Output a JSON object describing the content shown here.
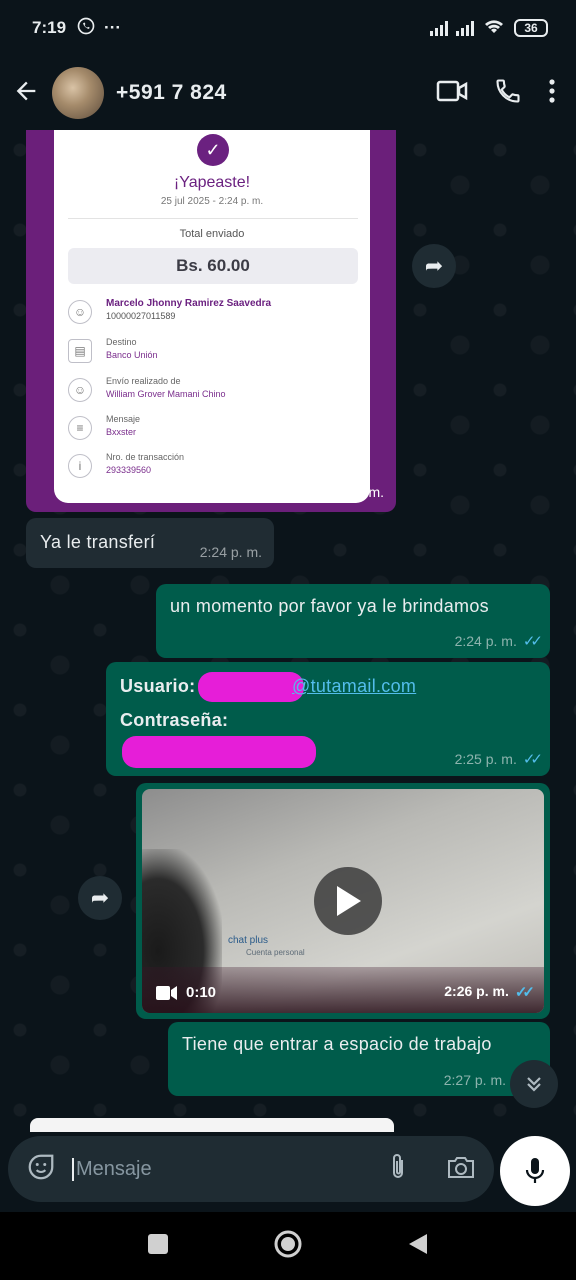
{
  "status_bar": {
    "time": "7:19",
    "more": "···",
    "battery": "36"
  },
  "header": {
    "contact": "+591 7   824"
  },
  "receipt": {
    "title": "¡Yapeaste!",
    "date": "25 jul 2025 - 2:24 p. m.",
    "total_label": "Total enviado",
    "amount": "Bs. 60.00",
    "rows": [
      {
        "label": "Marcelo Jhonny Ramirez Saavedra",
        "value": "10000027011589",
        "icon": "person-icon"
      },
      {
        "label": "Destino",
        "value": "Banco Unión",
        "icon": "bank-doc-icon"
      },
      {
        "label": "Envío realizado de",
        "value": "William Grover Mamani Chino",
        "icon": "person-icon"
      },
      {
        "label": "Mensaje",
        "value": "Bxxster",
        "icon": "message-icon"
      },
      {
        "label": "Nro. de transacción",
        "value": "293339560",
        "icon": "info-icon"
      }
    ],
    "time": "2:24 p. m."
  },
  "messages": [
    {
      "text": "Ya le transferí",
      "time": "2:24 p. m."
    },
    {
      "text": "un momento por favor ya le brindamos",
      "time": "2:24 p. m."
    },
    {
      "user_label": "Usuario:",
      "email_suffix": "@tutamail.com",
      "password_label": "Contraseña:",
      "time": "2:25 p. m."
    },
    {
      "duration": "0:10",
      "time": "2:26 p. m.",
      "brand": "chat plus",
      "brand_sub": "Cuenta personal"
    },
    {
      "text": "Tiene que entrar a espacio de trabajo",
      "time": "2:27 p. m."
    }
  ],
  "input": {
    "placeholder": "Mensaje"
  },
  "colors": {
    "outgoing": "#005c4b",
    "incoming": "#202c33",
    "tick": "#53bdeb",
    "receipt_purple": "#6b2180"
  }
}
